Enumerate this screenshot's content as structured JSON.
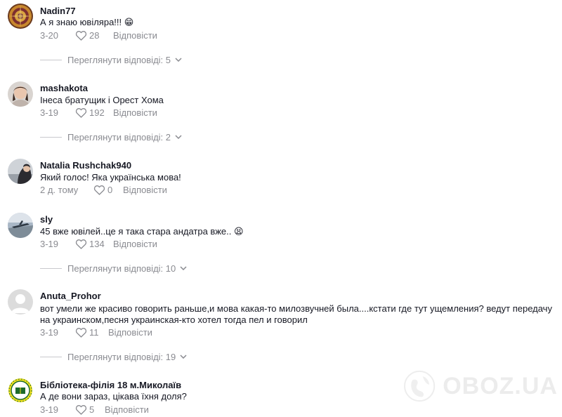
{
  "comments": [
    {
      "username": "Nadin77",
      "text": "А я знаю ювіляра!!! ",
      "emoji": "😁",
      "date": "3-20",
      "likes": "28",
      "reply_label": "Відповісти",
      "view_replies": "Переглянути відповіді: 5"
    },
    {
      "username": "mashakota",
      "text": "Інеса братущик і Орест Хома",
      "date": "3-19",
      "likes": "192",
      "reply_label": "Відповісти",
      "view_replies": "Переглянути відповіді: 2"
    },
    {
      "username": "Natalia Rushchak940",
      "text": "Який голос! Яка українська мова!",
      "date": "2 д. тому",
      "likes": "0",
      "reply_label": "Відповісти"
    },
    {
      "username": "sly",
      "text": "45 вже ювілей..це я така стара андатра вже.. ",
      "emoji": "😫",
      "date": "3-19",
      "likes": "134",
      "reply_label": "Відповісти",
      "view_replies": "Переглянути відповіді: 10"
    },
    {
      "username": "Anuta_Prohor",
      "text": "вот умели же красиво говорить раньше,и мова какая-то милозвучней была....кстати где тут ущемления? ведут передачу на украинском,песня украинская-кто хотел тогда пел и говорил",
      "date": "3-19",
      "likes": "11",
      "reply_label": "Відповісти",
      "view_replies": "Переглянути відповіді: 19"
    },
    {
      "username": "Бібліотека-філія 18 м.Миколаїв",
      "text": "А де вони зараз, цікава їхня доля?",
      "date": "3-19",
      "likes": "5",
      "reply_label": "Відповісти"
    }
  ],
  "watermark": "OBOZ.UA",
  "colors": {
    "primary_text": "#161823",
    "secondary_text": "#8a8b91",
    "divider": "#c9c9cd"
  },
  "icons": {
    "like": "heart-outline-icon",
    "expand": "chevron-down-icon"
  }
}
